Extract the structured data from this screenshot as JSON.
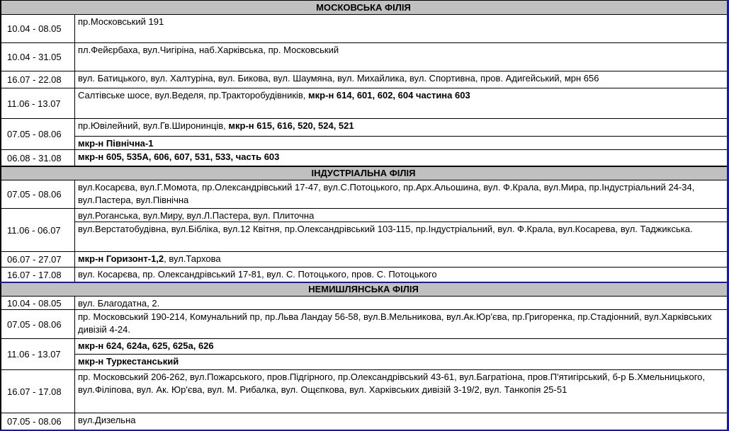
{
  "sections": [
    {
      "title": "МОСКОВСЬКА ФІЛІЯ",
      "rows": [
        {
          "date": "10.04 - 08.05",
          "lines": [
            [
              {
                "t": "пр.Московський 191"
              }
            ]
          ]
        },
        {
          "date": "10.04 - 31.05",
          "lines": [
            [
              {
                "t": "пл.Фейєрбаха, вул.Чигіріна, наб.Харківська, пр. Московський"
              }
            ]
          ]
        },
        {
          "date": "16.07 - 22.08",
          "lines": [
            [
              {
                "t": "вул. Батицького, вул. Халтуріна, вул. Бикова, вул. Шаумяна, вул. Михайлика, вул. Спортивна, пров. Адигейський, мрн 656"
              }
            ]
          ]
        },
        {
          "date": "11.06 - 13.07",
          "lines": [
            [
              {
                "t": "Салтівське шосе, вул.Веделя, пр.Тракторобудівників, "
              },
              {
                "t": "мкр-н 614, 601, 602, 604 частина 603",
                "b": true
              }
            ]
          ]
        },
        {
          "date": "07.05 - 08.06",
          "lines": [
            [
              {
                "t": "пр.Ювілейний, вул.Гв.Широнинців, "
              },
              {
                "t": "мкр-н 615, 616, 520, 524, 521",
                "b": true
              }
            ],
            [
              {
                "t": "мкр-н Північна-1",
                "b": true
              }
            ]
          ]
        },
        {
          "date": "06.08 - 31.08",
          "lines": [
            [
              {
                "t": "мкр-н 605, 535А, 606, 607, 531, 533, часть 603",
                "b": true
              }
            ]
          ]
        }
      ]
    },
    {
      "title": "ІНДУСТРІАЛЬНА ФІЛІЯ",
      "rows": [
        {
          "date": "07.05 - 08.06",
          "lines": [
            [
              {
                "t": "вул.Косарєва, вул.Г.Момота, пр.Олександрівський 17-47, вул.С.Потоцького, пр.Арх.Альошина, вул. Ф.Крала, вул.Мира, пр.Індустріальний 24-34, вул.Пастера, вул.Північна"
              }
            ]
          ]
        },
        {
          "date": "11.06 - 06.07",
          "lines": [
            [
              {
                "t": "вул.Роганська, вул.Миру, вул.Л.Пастера, вул. Плиточна"
              }
            ],
            [
              {
                "t": "вул.Верстатобудівна, вул.Бібліка, вул.12 Квітня, пр.Олександрівський 103-115, пр.Індустріальний, вул. Ф.Крала, вул.Косарева, вул. Таджикська."
              }
            ]
          ]
        },
        {
          "date": "06.07 - 27.07",
          "lines": [
            [
              {
                "t": "мкр-н Горизонт-1,2",
                "b": true
              },
              {
                "t": ", вул.Тархова"
              }
            ]
          ]
        },
        {
          "date": "16.07 - 17.08",
          "lines": [
            [
              {
                "t": "вул. Косарєва, пр. Олександрівський 17-81, вул. С. Потоцького, пров. С. Потоцького"
              }
            ]
          ]
        }
      ]
    },
    {
      "title": "НЕМИШЛЯНСЬКА ФІЛІЯ",
      "rows": [
        {
          "date": "10.04 - 08.05",
          "lines": [
            [
              {
                "t": "вул. Благодатна, 2."
              }
            ]
          ]
        },
        {
          "date": "07.05 - 08.06",
          "lines": [
            [
              {
                "t": "пр. Московський 190-214, Комунальний пр,  пр.Льва Ландау 56-58, вул.В.Мельникова, вул.Ак.Юр'єва, пр.Григоренка, пр.Стадіонний, вул.Харківських дивізій 4-24."
              }
            ]
          ]
        },
        {
          "date": "11.06 - 13.07",
          "lines": [
            [
              {
                "t": "мкр-н 624, 624а, 625, 625а, 626",
                "b": true
              }
            ],
            [
              {
                "t": "мкр-н Туркестанський",
                "b": true
              }
            ]
          ]
        },
        {
          "date": "16.07 - 17.08",
          "lines": [
            [
              {
                "t": "пр. Московський 206-262, вул.Пожарського, пров.Підгірного, пр.Олександрівський 43-61,  вул.Багратіона, пров.П'ятигірський, б-р Б.Хмельницького, вул.Філіпова, вул. Ак. Юр'єва, вул. М. Рибалка, вул. Ощєпкова, вул. Харківських дивізій 3-19/2, вул. Танкопія 25-51"
              }
            ]
          ]
        },
        {
          "date": "07.05 - 08.06",
          "lines": [
            [
              {
                "t": "вул.Дизельна"
              }
            ]
          ]
        }
      ]
    }
  ]
}
